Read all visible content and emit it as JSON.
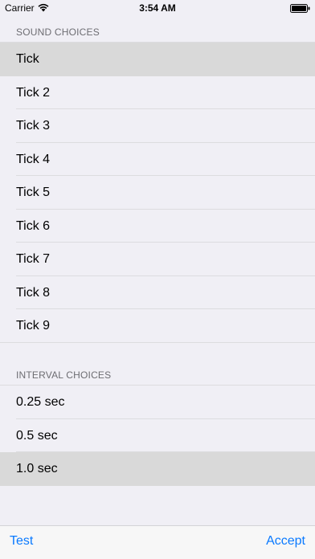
{
  "status_bar": {
    "carrier": "Carrier",
    "time": "3:54 AM",
    "wifi_icon": "wifi-icon",
    "battery_icon": "battery-icon"
  },
  "sound_section": {
    "header": "SOUND CHOICES",
    "items": [
      {
        "label": "Tick",
        "selected": true
      },
      {
        "label": "Tick 2",
        "selected": false
      },
      {
        "label": "Tick 3",
        "selected": false
      },
      {
        "label": "Tick 4",
        "selected": false
      },
      {
        "label": "Tick 5",
        "selected": false
      },
      {
        "label": "Tick 6",
        "selected": false
      },
      {
        "label": "Tick 7",
        "selected": false
      },
      {
        "label": "Tick 8",
        "selected": false
      },
      {
        "label": "Tick 9",
        "selected": false
      }
    ]
  },
  "interval_section": {
    "header": "INTERVAL CHOICES",
    "items": [
      {
        "label": "0.25 sec",
        "selected": false
      },
      {
        "label": "0.5 sec",
        "selected": false
      },
      {
        "label": "1.0 sec",
        "selected": true
      }
    ]
  },
  "toolbar": {
    "test_label": "Test",
    "accept_label": "Accept"
  },
  "colors": {
    "background": "#f0eff5",
    "selected_row": "#d9d9d9",
    "accent": "#0a7aff",
    "section_header": "#6d6d72"
  }
}
